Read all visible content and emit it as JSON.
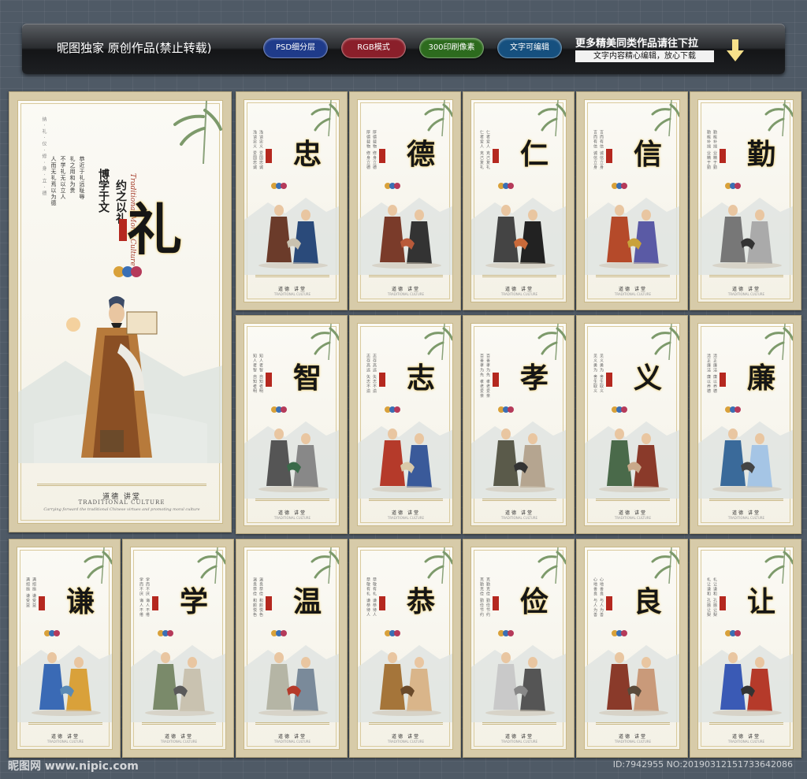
{
  "banner": {
    "title": "昵图独家 原创作品(禁止转载)",
    "pills": [
      {
        "label": "PSD细分层",
        "color": "#1f3b8a"
      },
      {
        "label": "RGB模式",
        "color": "#8a1f2a"
      },
      {
        "label": "300印刷像素",
        "color": "#2d6b1e"
      },
      {
        "label": "文字可编辑",
        "color": "#16507f"
      }
    ],
    "promo": "更多精美同类作品请往下拉",
    "promo_sub": "文字内容精心编辑，放心下载"
  },
  "main_poster": {
    "character": "礼",
    "motto_line1": "博学于文",
    "motto_line2": "约之以礼",
    "english_title": "Traditional Moral Culture",
    "footer_brand": "道德 讲堂",
    "caption": "TRADITIONAL CULTURE",
    "description": "Carrying forward the traditional Chinese virtues and promoting moral culture"
  },
  "posters": [
    {
      "character": "忠",
      "text": "浅谈忠义 爱国忠诚"
    },
    {
      "character": "德",
      "text": "厚德载物 修身立德"
    },
    {
      "character": "仁",
      "text": "仁者爱人 克己复礼"
    },
    {
      "character": "信",
      "text": "言而有信 诚信立身"
    },
    {
      "character": "勤",
      "text": "勤能补拙 业精于勤"
    },
    {
      "character": "智",
      "text": "知人者智 自知者明"
    },
    {
      "character": "志",
      "text": "志存高远 矢志不渝"
    },
    {
      "character": "孝",
      "text": "百善孝为先 孝老爱亲"
    },
    {
      "character": "义",
      "text": "见义勇为 舍生取义"
    },
    {
      "character": "廉",
      "text": "清正廉洁 廉以养德"
    },
    {
      "character": "谦",
      "text": "满招损 谦受益"
    },
    {
      "character": "学",
      "text": "学而不厌 诲人不倦"
    },
    {
      "character": "温",
      "text": "温良恭俭 和颜悦色"
    },
    {
      "character": "恭",
      "text": "恭敬有礼 谦恭待人"
    },
    {
      "character": "俭",
      "text": "克勤克俭 勤俭节约"
    },
    {
      "character": "良",
      "text": "心地善良 与人为善"
    },
    {
      "character": "让",
      "text": "礼让谦和 孔融让梨"
    }
  ],
  "poster_footer": "道德 讲堂",
  "watermark": {
    "left": "昵图网 www.nipic.com",
    "right": "ID:7942955 NO:20190312151733642086"
  },
  "colors": {
    "background": "#4f5a66",
    "frame": "#d7cba9",
    "character_glow": "#e8c456",
    "seal_red": "#b5281f"
  }
}
